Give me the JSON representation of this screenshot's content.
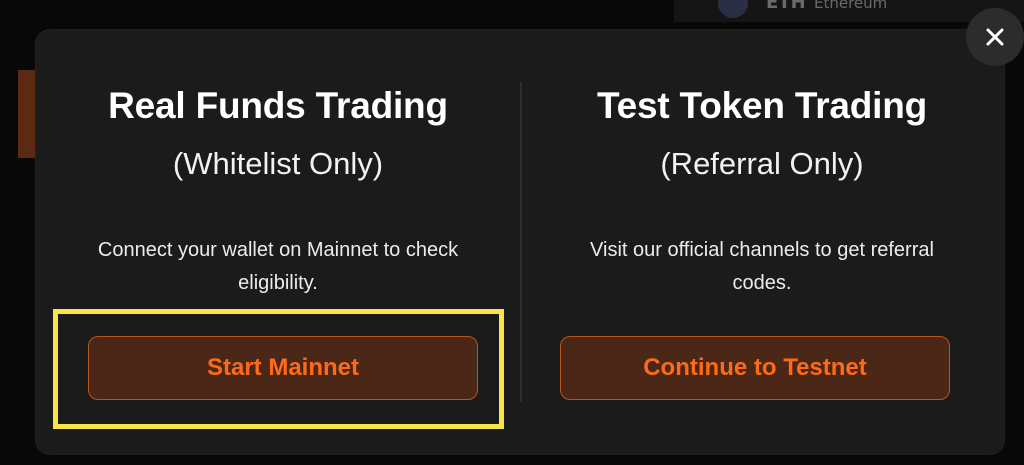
{
  "background": {
    "header_symbol": "ETH",
    "header_name": "Ethereum"
  },
  "modal": {
    "close_label": "×",
    "left": {
      "title": "Real Funds Trading",
      "subtitle": "(Whitelist Only)",
      "description": "Connect your wallet on Mainnet to check eligibility.",
      "button_label": "Start Mainnet"
    },
    "right": {
      "title": "Test Token Trading",
      "subtitle": "(Referral Only)",
      "description": "Visit our official channels to get referral codes.",
      "button_label": "Continue to Testnet"
    }
  },
  "colors": {
    "accent": "#ff6a1a",
    "button_bg": "#4a2716",
    "highlight": "#f7e54a",
    "modal_bg": "#1b1b1b"
  },
  "icons": {
    "close": "close-icon",
    "token": "ethereum-icon"
  }
}
